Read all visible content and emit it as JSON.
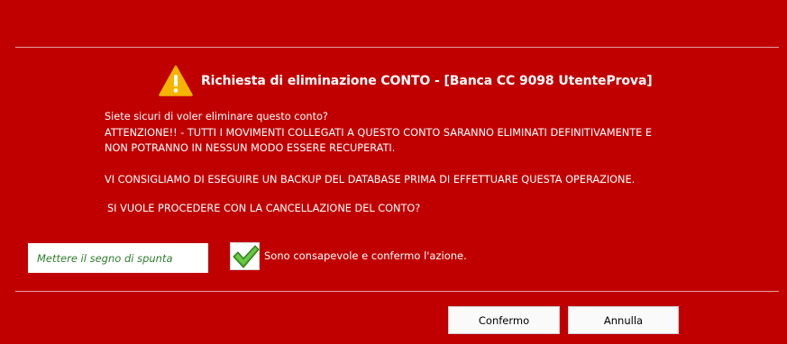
{
  "dialog": {
    "title": "Richiesta di eliminazione CONTO - [Banca CC 9098 UtenteProva]",
    "icon": "warning-icon",
    "accent_color": "#c00000",
    "warning_color": "#f5b400"
  },
  "message": {
    "line1": "Siete sicuri di voler eliminare questo conto?",
    "line2": "ATTENZIONE!! - TUTTI I MOVIMENTI COLLEGATI A QUESTO CONTO SARANNO ELIMINATI DEFINITIVAMENTE E",
    "line3": "NON POTRANNO IN NESSUN MODO ESSERE RECUPERATI.",
    "line4": "VI CONSIGLIAMO DI ESEGUIRE UN BACKUP DEL DATABASE PRIMA DI EFFETTUARE QUESTA OPERAZIONE.",
    "line5": "SI VUOLE PROCEDERE CON LA CANCELLAZIONE DEL CONTO?"
  },
  "confirmation": {
    "hint": "Mettere il segno di spunta",
    "checkbox_label": "Sono consapevole e confermo l'azione.",
    "checked": true,
    "check_icon": "green-checkmark-icon"
  },
  "buttons": {
    "confirm_label": "Confermo",
    "cancel_label": "Annulla"
  }
}
